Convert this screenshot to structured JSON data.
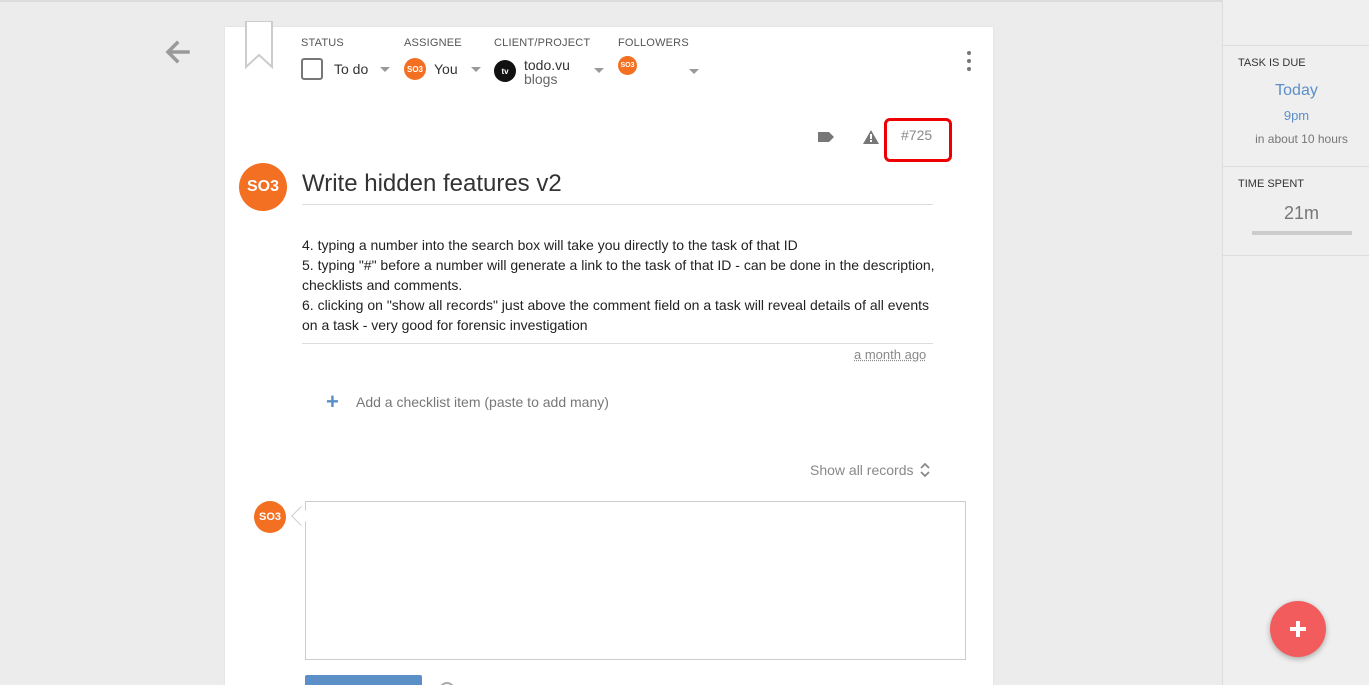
{
  "header": {
    "status": {
      "label": "STATUS",
      "value": "To do"
    },
    "assignee": {
      "label": "ASSIGNEE",
      "avatar": "SO3",
      "value": "You"
    },
    "client_project": {
      "label": "CLIENT/PROJECT",
      "logo": "tv",
      "client": "todo.vu",
      "project": "blogs"
    },
    "followers": {
      "label": "FOLLOWERS",
      "avatar": "SO3"
    }
  },
  "task": {
    "id": "#725",
    "avatar": "SO3",
    "title": "Write hidden features v2",
    "description": [
      "4. typing a number into the search box will take you directly to the task of that ID",
      "5. typing \"#\" before a number will generate a link to the task of that ID - can be done in the description, checklists and comments.",
      "6. clicking on \"show all records\" just above the comment field on a task will reveal details of all events on a task - very good for forensic investigation"
    ],
    "time_ago": "a month ago"
  },
  "checklist": {
    "add_label": "Add a checklist item (paste to add many)"
  },
  "records": {
    "show_all_label": "Show all records"
  },
  "comment": {
    "avatar": "SO3"
  },
  "sidebar": {
    "due": {
      "label": "TASK IS DUE",
      "day": "Today",
      "time": "9pm",
      "relative": "in about 10 hours"
    },
    "time_spent": {
      "label": "TIME SPENT",
      "value": "21m"
    }
  },
  "colors": {
    "accent_blue": "#5b8fc7",
    "avatar_orange": "#f36f21",
    "fab_red": "#f25c5c",
    "highlight": "#ee0000"
  }
}
